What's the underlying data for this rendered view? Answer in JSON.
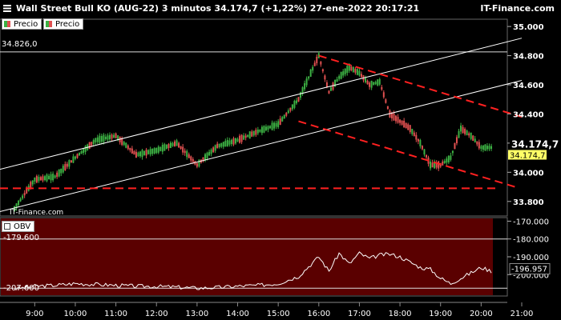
{
  "header": {
    "title": "Wall Street Bull KO (AUG-22) 3 minutos 34.174,7 (+1,22%) 27-ene-2022 20:17:21",
    "brand": "IT-Finance.com"
  },
  "legend": {
    "price_a": "Precio",
    "price_b": "Precio",
    "obv": "OBV"
  },
  "watermark": "IT-Finance.com",
  "colors": {
    "up": "#3cb043",
    "down": "#e05050",
    "trend": "#ff2020",
    "obv_fill": "#5a0000"
  },
  "chart_data": [
    {
      "type": "candlestick",
      "title": "Wall Street Bull KO (AUG-22) 3 minutos",
      "ylim": [
        33.7,
        35.05
      ],
      "y_ticks": [
        "35.000",
        "34.800",
        "34.600",
        "34.400",
        "34.200",
        "34.000",
        "33.800"
      ],
      "x_ticks": [
        "9:00",
        "10:00",
        "11:00",
        "12:00",
        "13:00",
        "14:00",
        "15:00",
        "16:00",
        "17:00",
        "18:00",
        "19:00",
        "20:00",
        "21:00"
      ],
      "last_price": "34.174,7",
      "last_label": "34.174,7",
      "range_high_label": "34.826,0",
      "series": [
        {
          "name": "Precio",
          "x": [
            "8:30",
            "9:00",
            "9:30",
            "10:00",
            "10:30",
            "11:00",
            "11:30",
            "12:00",
            "12:30",
            "13:00",
            "13:30",
            "14:00",
            "14:30",
            "15:00",
            "15:30",
            "16:00",
            "16:15",
            "16:30",
            "16:45",
            "17:00",
            "17:15",
            "17:30",
            "17:45",
            "18:00",
            "18:15",
            "18:30",
            "18:45",
            "19:00",
            "19:15",
            "19:30",
            "19:45",
            "20:00",
            "20:15"
          ],
          "values": [
            33.75,
            33.95,
            33.97,
            34.1,
            34.22,
            34.25,
            34.12,
            34.15,
            34.2,
            34.05,
            34.18,
            34.22,
            34.28,
            34.33,
            34.5,
            34.8,
            34.55,
            34.65,
            34.72,
            34.68,
            34.6,
            34.62,
            34.4,
            34.35,
            34.3,
            34.2,
            34.05,
            34.05,
            34.1,
            34.3,
            34.25,
            34.17,
            34.17
          ]
        }
      ],
      "channel_lines": [
        {
          "x": [
            "8:00",
            "21:00"
          ],
          "values": [
            34.01,
            34.92
          ]
        },
        {
          "x": [
            "8:00",
            "21:00"
          ],
          "values": [
            33.72,
            34.63
          ]
        }
      ],
      "trend_lines": [
        {
          "x": [
            "16:00",
            "21:00"
          ],
          "values": [
            34.8,
            34.38
          ]
        },
        {
          "x": [
            "15:30",
            "20:50"
          ],
          "values": [
            34.35,
            33.9
          ]
        }
      ],
      "hline": 33.89,
      "resistance_line": 34.826
    },
    {
      "type": "area",
      "title": "OBV",
      "ylim": [
        -212,
        -168
      ],
      "y_ticks": [
        "-170.000",
        "-180.000",
        "-190.000",
        "-200.000"
      ],
      "last_value": "-196.957",
      "high_label": "-179.600",
      "low_label": "-207.600",
      "series": [
        {
          "name": "OBV",
          "x": [
            "8:30",
            "9:00",
            "9:30",
            "10:00",
            "10:30",
            "11:00",
            "11:30",
            "12:00",
            "12:30",
            "13:00",
            "13:30",
            "14:00",
            "14:30",
            "15:00",
            "15:30",
            "16:00",
            "16:15",
            "16:30",
            "16:45",
            "17:00",
            "17:15",
            "17:30",
            "17:45",
            "18:00",
            "18:15",
            "18:30",
            "18:45",
            "19:00",
            "19:15",
            "19:30",
            "19:45",
            "20:00",
            "20:15"
          ],
          "values": [
            -208,
            -206.5,
            -206,
            -205,
            -205.5,
            -206,
            -206.5,
            -206.6,
            -207,
            -207.6,
            -207.2,
            -206.5,
            -206,
            -205,
            -201,
            -190,
            -198,
            -188,
            -194,
            -188,
            -191,
            -189,
            -188.5,
            -190,
            -193,
            -196,
            -197,
            -202,
            -205,
            -202,
            -199,
            -196,
            -198
          ]
        }
      ]
    }
  ]
}
